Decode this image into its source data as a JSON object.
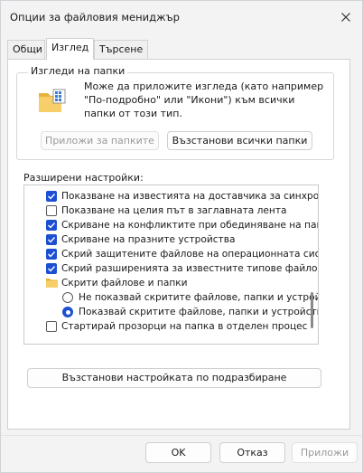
{
  "window": {
    "title": "Опции за файловия мениджър"
  },
  "tabs": [
    {
      "label": "Общи"
    },
    {
      "label": "Изглед"
    },
    {
      "label": "Търсене"
    }
  ],
  "folder_views": {
    "legend": "Изгледи на папки",
    "description": "Може да приложите изгледа (като например \"По-подробно\" или \"Икони\") към всички папки от този тип.",
    "apply_button": "Приложи за папките",
    "reset_button": "Възстанови всички папки"
  },
  "advanced": {
    "label": "Разширени настройки:",
    "items": [
      {
        "text": "Показване на известията на доставчика за синхрони",
        "control": "checkbox",
        "checked": true
      },
      {
        "text": "Показване на целия път в заглавната лента",
        "control": "checkbox",
        "checked": false
      },
      {
        "text": "Скриване на конфликтите при обединяване на папки",
        "control": "checkbox",
        "checked": true
      },
      {
        "text": "Скриване на празните устройства",
        "control": "checkbox",
        "checked": true
      },
      {
        "text": "Скрий защитените файлове на операционната систе",
        "control": "checkbox",
        "checked": true
      },
      {
        "text": "Скрий разширенията за известните типове файлове",
        "control": "checkbox",
        "checked": true
      },
      {
        "text": "Скрити файлове и папки",
        "control": "folder"
      },
      {
        "text": "Не показвай скритите файлове, папки и устройст",
        "control": "radio",
        "checked": false
      },
      {
        "text": "Показвай скритите файлове, папки и устройства",
        "control": "radio",
        "checked": true
      },
      {
        "text": "Стартирай прозорци на папка в отделен процес",
        "control": "checkbox",
        "checked": false
      }
    ]
  },
  "restore_defaults_button": "Възстанови настройката по подразбиране",
  "footer": {
    "ok": "OK",
    "cancel": "Отказ",
    "apply": "Приложи"
  },
  "colors": {
    "accent": "#1c4fd1",
    "folder": "#f2c14e"
  }
}
